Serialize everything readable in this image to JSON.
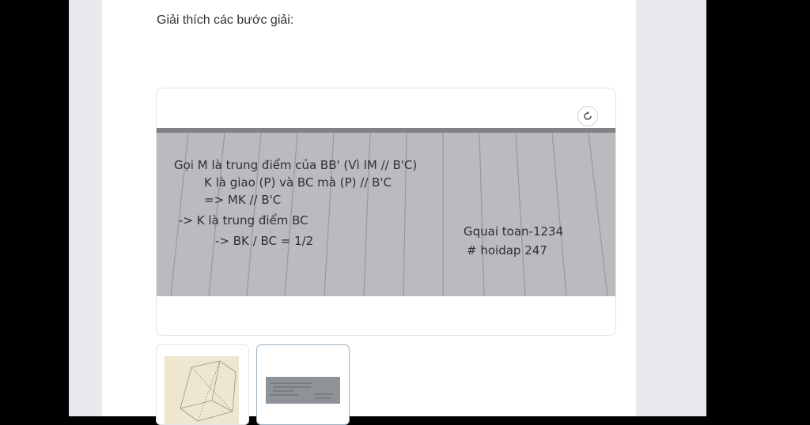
{
  "page": {
    "heading": "Giải thích các bước giải:"
  },
  "image_viewer": {
    "rotate_icon": "rotate-icon",
    "handwritten_lines": [
      "Gọi M là trung điểm của BB' (Vì IM // B'C)",
      "K là giao (P) và BC mà (P) // B'C",
      "=> MK // B'C",
      "-> K là trung điểm BC",
      "-> BK / BC = 1/2",
      "Gquai toan-1234",
      "# hoidap 247"
    ]
  },
  "thumbnails": [
    {
      "name": "geometry-sketch-thumbnail",
      "selected": false
    },
    {
      "name": "handwritten-notes-thumbnail",
      "selected": true
    }
  ]
}
